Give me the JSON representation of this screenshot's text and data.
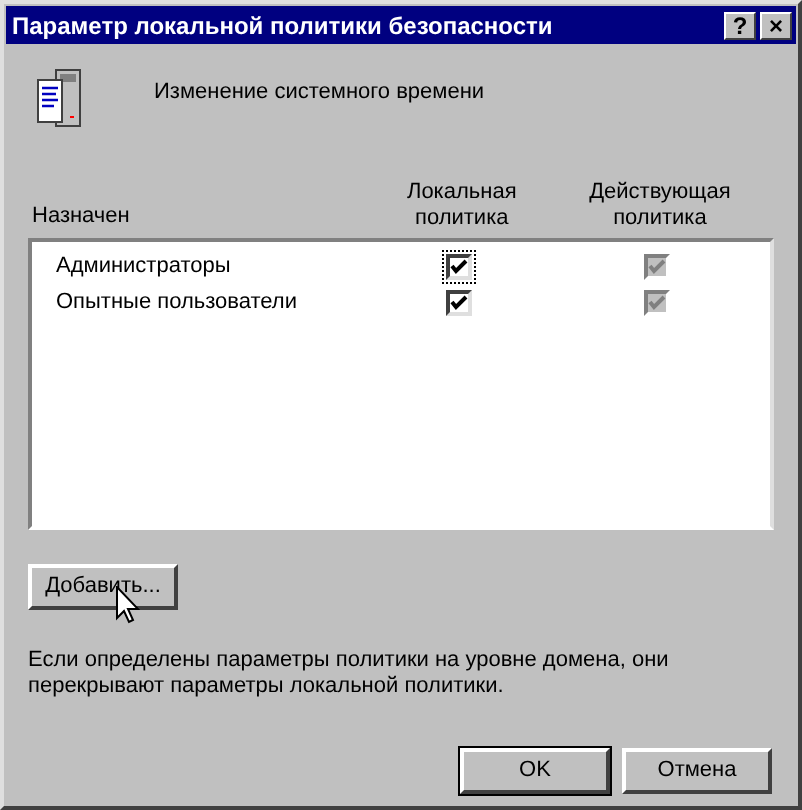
{
  "window": {
    "title": "Параметр локальной политики безопасности",
    "buttons": [
      "?",
      "×"
    ]
  },
  "policy_name": "Изменение системного времени",
  "columns": [
    {
      "label": "Назначен"
    },
    {
      "label": "Локальная политика"
    },
    {
      "label": "Действующая политика"
    }
  ],
  "rows": [
    {
      "name": "Администраторы",
      "local": {
        "checked": true,
        "disabled": false,
        "focused": true
      },
      "effective": {
        "checked": true,
        "disabled": true,
        "focused": false
      }
    },
    {
      "name": "Опытные пользователи",
      "local": {
        "checked": true,
        "disabled": false,
        "focused": false
      },
      "effective": {
        "checked": true,
        "disabled": true,
        "focused": false
      }
    }
  ],
  "add_button": "Добавить...",
  "note": "Если определены параметры политики на уровне домена, они перекрывают параметры локальной политики.",
  "footer_buttons": [
    {
      "label": "OK",
      "default": true
    },
    {
      "label": "Отмена",
      "default": false
    }
  ]
}
